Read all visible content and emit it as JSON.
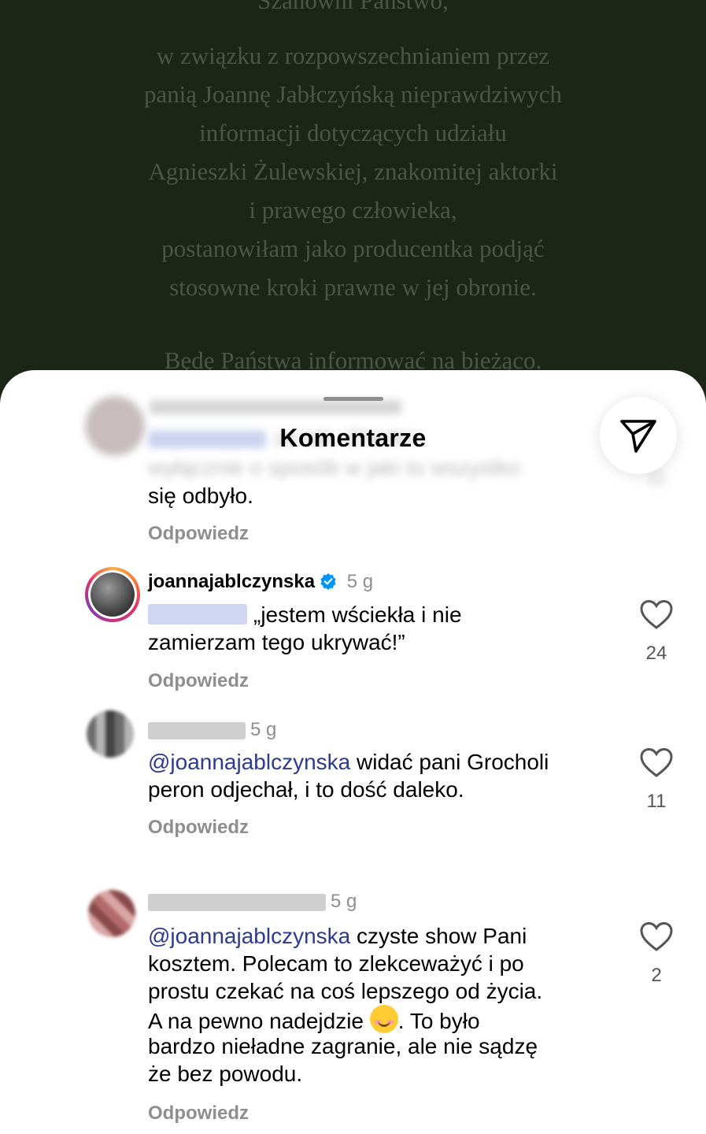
{
  "story": {
    "heading": "Szanowni Państwo,",
    "body_lines": [
      "w związku z rozpowszechnianiem przez",
      "panią Joannę Jabłczyńską nieprawdziwych",
      "informacji dotyczących udziału",
      "Agnieszki Żulewskiej, znakomitej aktorki",
      "i prawego człowieka,",
      "postanowiłam jako producentka podjąć",
      "stosowne kroki prawne w jej obronie."
    ],
    "footer": "Będę Państwa informować na bieżąco."
  },
  "sheet": {
    "title": "Komentarze",
    "send_icon": "send-paper-plane-icon"
  },
  "comments": [
    {
      "text_blurred_1": "ze tak. Chodzi",
      "text_blurred_2": "wyłącznie o sposób w jaki to wszystko",
      "text_visible": "się odbyło.",
      "reply_label": "Odpowiedz",
      "likes": "11"
    },
    {
      "username": "joannajablczynska",
      "verified": true,
      "time": "5 g",
      "text_line_1": "„jestem wściekła i nie",
      "text_line_2": "zamierzam tego ukrywać!”",
      "reply_label": "Odpowiedz",
      "likes": "24"
    },
    {
      "time": "5 g",
      "mention": "@joannajablczynska",
      "text_line_1": " widać pani Grocholi",
      "text_line_2": "peron odjechał, i to dość daleko.",
      "reply_label": "Odpowiedz",
      "likes": "11"
    },
    {
      "time": "5 g",
      "mention": "@joannajablczynska",
      "text_line_1": " czyste show Pani",
      "text_line_2": "kosztem. Polecam to zlekceważyć i po",
      "text_line_3": "prostu czekać na coś lepszego od życia.",
      "text_line_4_a": "A na pewno nadejdzie ",
      "text_line_4_b": ". To było",
      "text_line_5": "bardzo nieładne zagranie, ale nie sądzę",
      "text_line_6": "że bez powodu.",
      "emoji": "smiling-face",
      "reply_label": "Odpowiedz",
      "likes": "2"
    }
  ],
  "colors": {
    "story_bg": "#1c2617",
    "mention": "#2c3a8f",
    "secondary": "#8e8e8e",
    "verified": "#0095f6"
  }
}
